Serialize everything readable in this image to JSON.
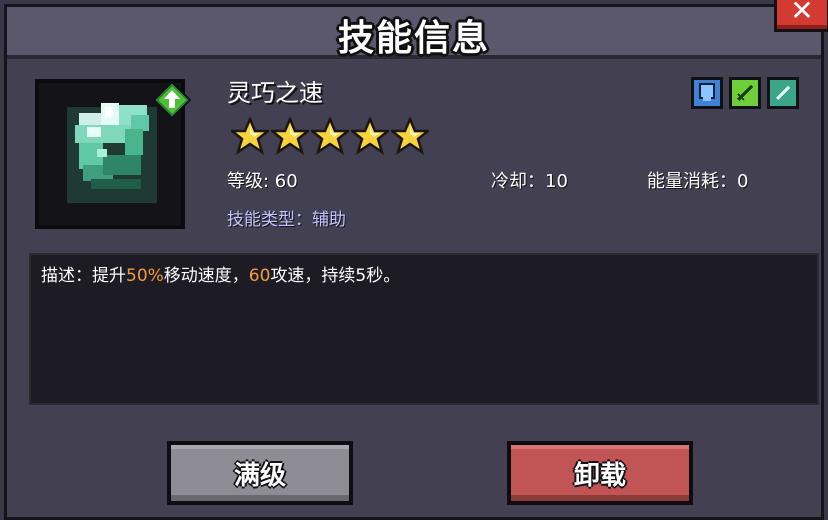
{
  "header": {
    "title": "技能信息",
    "close_icon": "close-x-icon"
  },
  "skill": {
    "name": "灵巧之速",
    "icon": "green-boot-icon",
    "upgrade_badge": "upgrade-arrow-icon",
    "stars": 5,
    "level_label": "等级: 60",
    "cooldown_label": "冷却：10",
    "energy_label": "能量消耗：0",
    "type_label": "技能类型：辅助",
    "tags": [
      {
        "name": "shield-tag-icon",
        "color": "#3f82d6"
      },
      {
        "name": "sword-tag-icon",
        "color": "#6fcf3a"
      },
      {
        "name": "blade-tag-icon",
        "color": "#3aa589"
      }
    ]
  },
  "description": {
    "prefix": "描述：提升",
    "value1": "50%",
    "mid": "移动速度，",
    "value2": "60",
    "suffix": "攻速，持续5秒。"
  },
  "buttons": {
    "max_label": "满级",
    "unload_label": "卸载"
  },
  "colors": {
    "highlight": "#f39a3d",
    "star": "#f7d23a"
  }
}
